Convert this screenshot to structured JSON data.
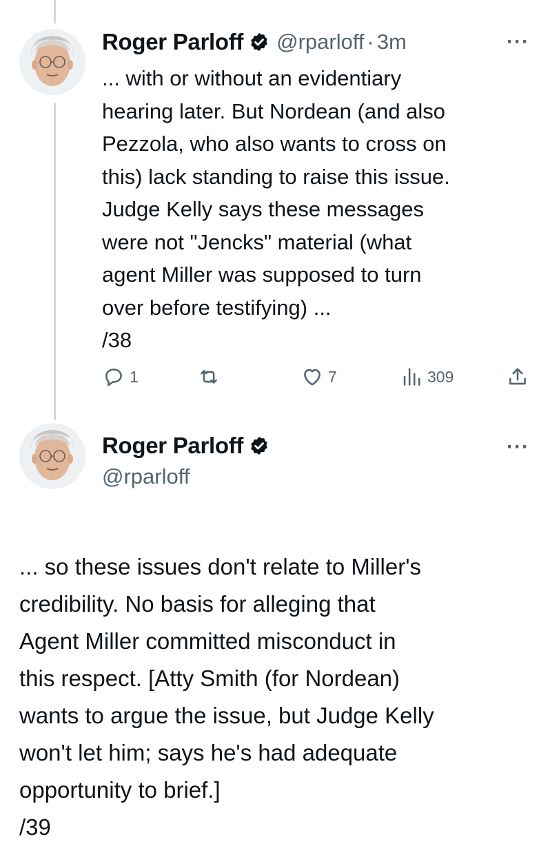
{
  "tweet1": {
    "name": "Roger Parloff",
    "handle": "@rparloff",
    "separator": "·",
    "time": "3m",
    "more": "···",
    "text": "... with or without an evidentiary\nhearing later. But Nordean (and also\nPezzola, who also wants to cross on\nthis) lack standing to raise this issue.\nJudge Kelly says these messages\nwere not \"Jencks\" material (what\nagent Miller was supposed to turn\nover before testifying) ...\n/38",
    "actions": {
      "replies": "1",
      "retweets": "",
      "likes": "7",
      "views": "309"
    }
  },
  "tweet2": {
    "name": "Roger Parloff",
    "handle": "@rparloff",
    "more": "···",
    "text": "... so these issues don't relate to Miller's\ncredibility. No basis for alleging that\nAgent Miller committed misconduct in\nthis respect. [Atty Smith (for Nordean)\nwants to argue the issue, but Judge Kelly\nwon't let him; says he's had adequate\nopportunity to brief.]\n/39"
  },
  "colors": {
    "text": "#0f1419",
    "secondary": "#536471",
    "verified": "#1d9bf0",
    "thread_line": "#cfd9de"
  }
}
